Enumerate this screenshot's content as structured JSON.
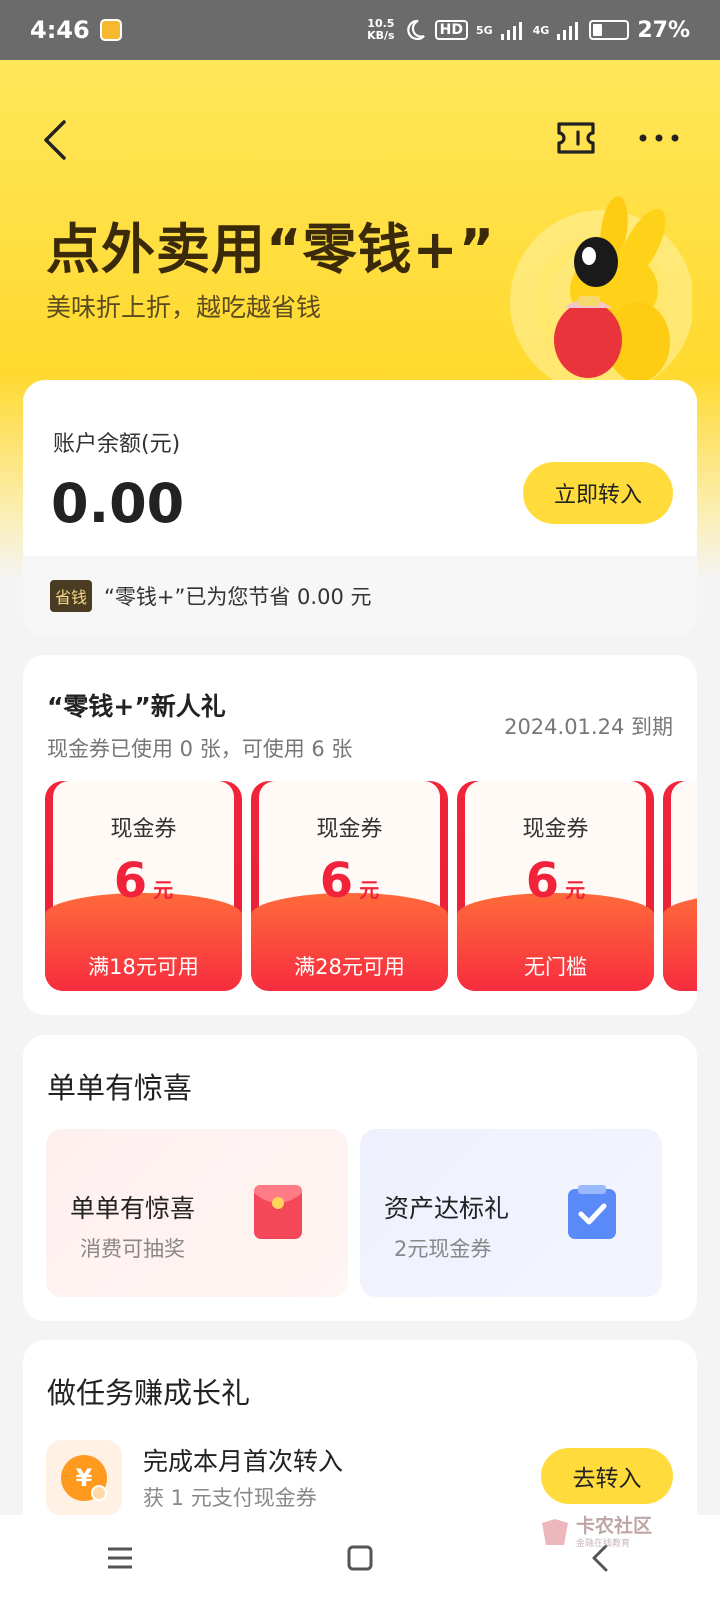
{
  "status_bar": {
    "time": "4:46",
    "net_speed_value": "10.5",
    "net_speed_unit": "KB/s",
    "hd_label": "HD",
    "net_5g": "5G",
    "net_4g": "4G",
    "battery_text": "27%",
    "battery_level": 0.27
  },
  "colors": {
    "accent_yellow": "#ffdc3c",
    "coupon_red": "#f0233a",
    "title_brown": "#3a2a0a"
  },
  "hero": {
    "title": "点外卖用“零钱+”",
    "subtitle": "美味折上折，越吃越省钱"
  },
  "balance": {
    "label": "账户余额(元)",
    "value": "0.00",
    "transfer_button": "立即转入",
    "saved_tag": "省钱",
    "saved_text": "“零钱+”已为您节省 0.00 元"
  },
  "gift": {
    "title": "“零钱+”新人礼",
    "subtitle": "现金券已使用 0 张，可使用 6 张",
    "expire": "2024.01.24 到期",
    "coupons": [
      {
        "name": "现金券",
        "amount": "6",
        "unit": "元",
        "condition": "满18元可用"
      },
      {
        "name": "现金券",
        "amount": "6",
        "unit": "元",
        "condition": "满28元可用"
      },
      {
        "name": "现金券",
        "amount": "6",
        "unit": "元",
        "condition": "无门槛"
      }
    ]
  },
  "surprise": {
    "title": "单单有惊喜",
    "tiles": [
      {
        "name": "单单有惊喜",
        "sub": "消费可抽奖",
        "icon": "red-envelope-icon"
      },
      {
        "name": "资产达标礼",
        "sub": "2元现金券",
        "icon": "checklist-icon"
      }
    ]
  },
  "tasks": {
    "title": "做任务赚成长礼",
    "items": [
      {
        "name": "完成本月首次转入",
        "sub": "获 1 元支付现金券",
        "button": "去转入",
        "icon": "yuan-coin-icon"
      }
    ]
  },
  "watermark": {
    "text": "卡农社区",
    "sub": "金融在线教育"
  }
}
